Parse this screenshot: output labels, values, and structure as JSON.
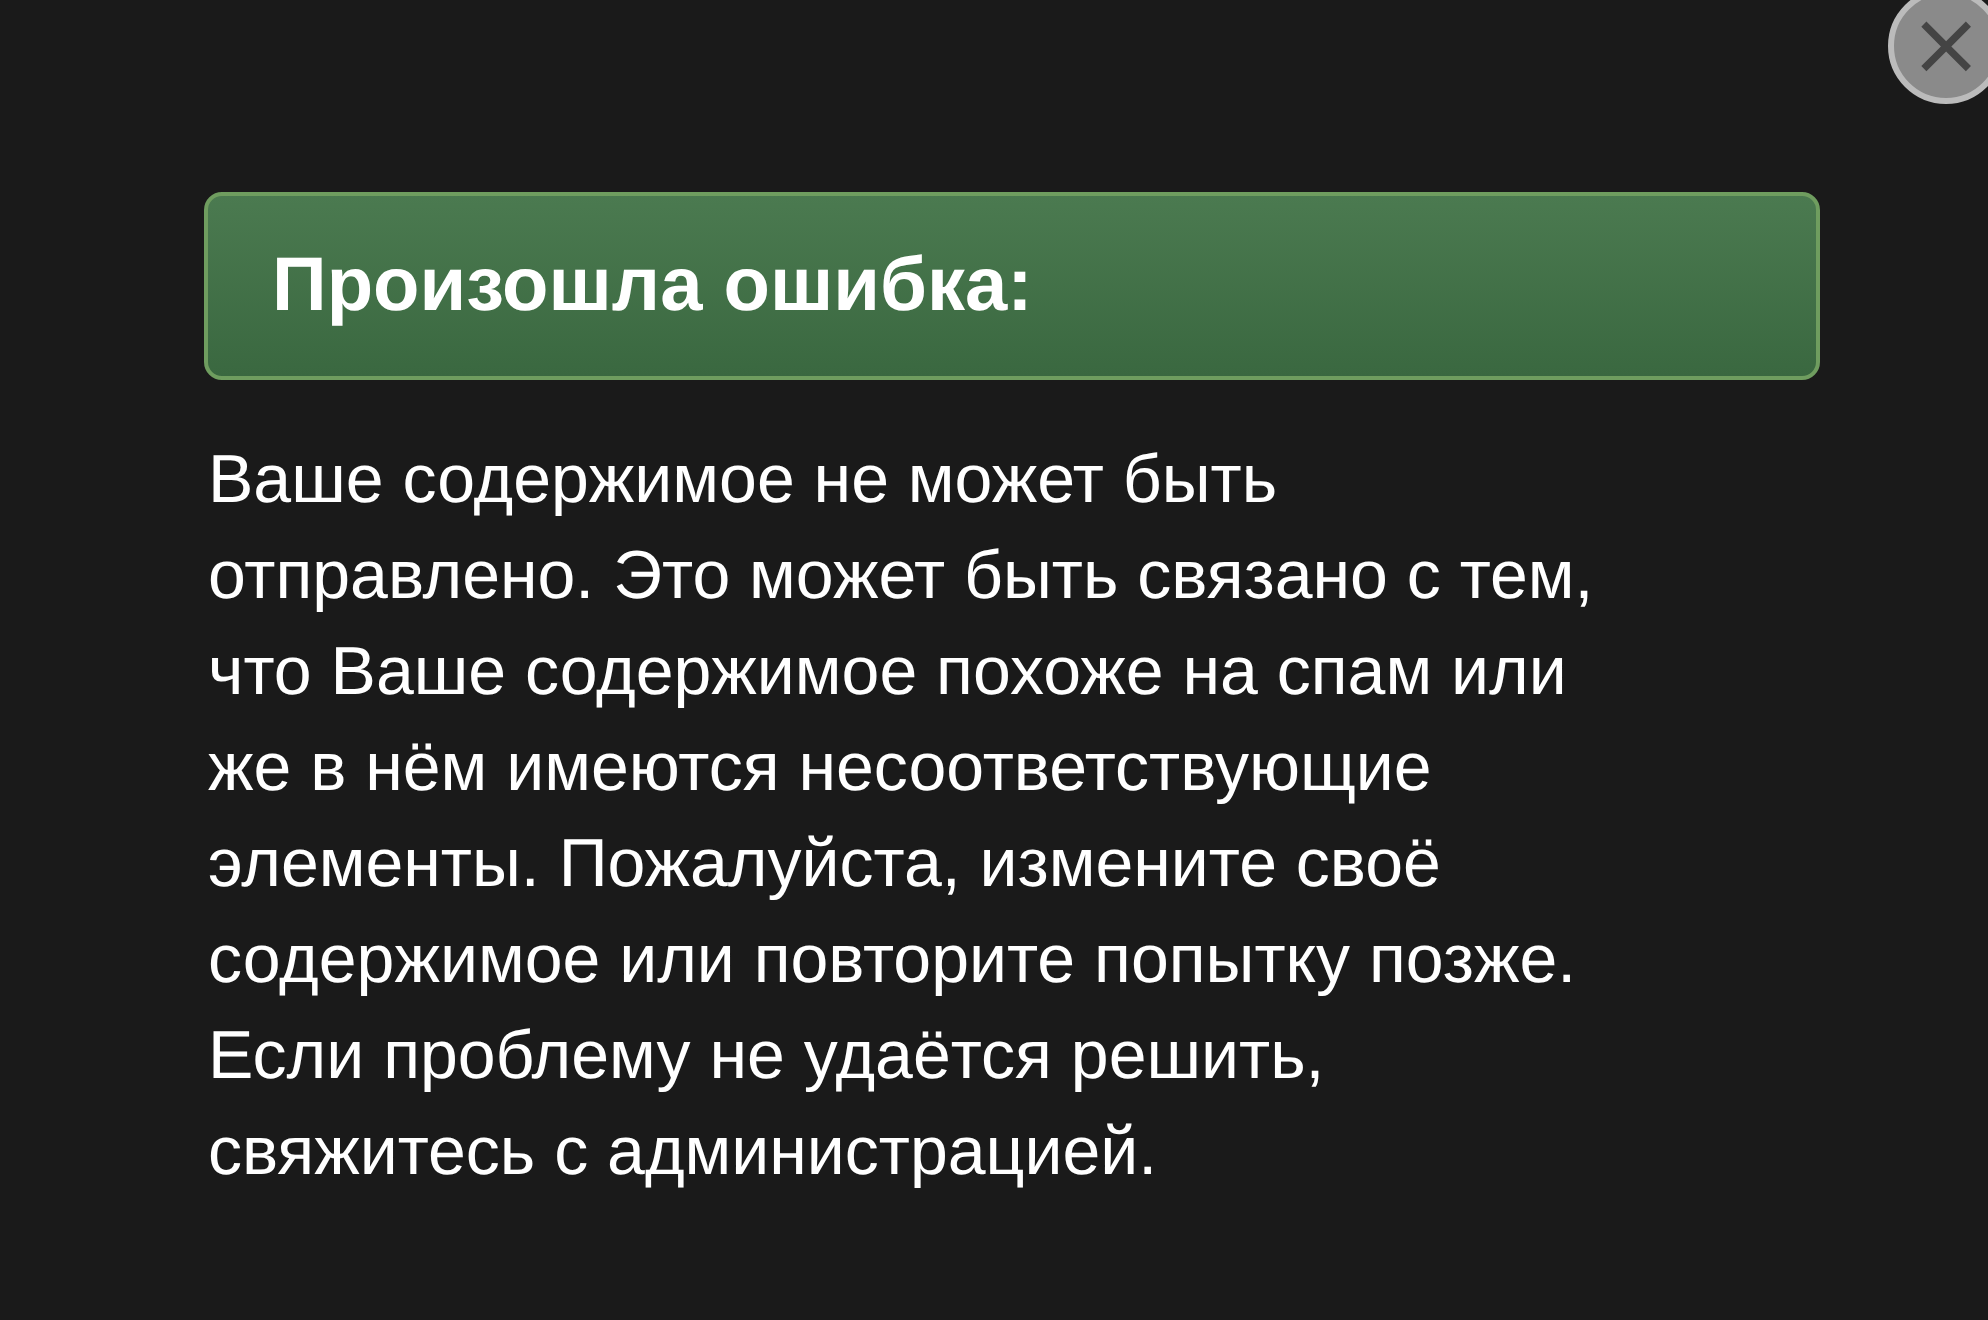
{
  "dialog": {
    "title": "Произошла ошибка:",
    "message_lines": [
      "Ваше содержимое не может быть",
      "отправлено. Это может быть связано с тем,",
      "что Ваше содержимое похоже на спам или",
      "же в нём имеются несоответствующие",
      "элементы. Пожалуйста, измените своё",
      "содержимое или повторите попытку позже.",
      "Если проблему не удаётся решить,",
      "свяжитесь с администрацией."
    ],
    "close": "×"
  }
}
